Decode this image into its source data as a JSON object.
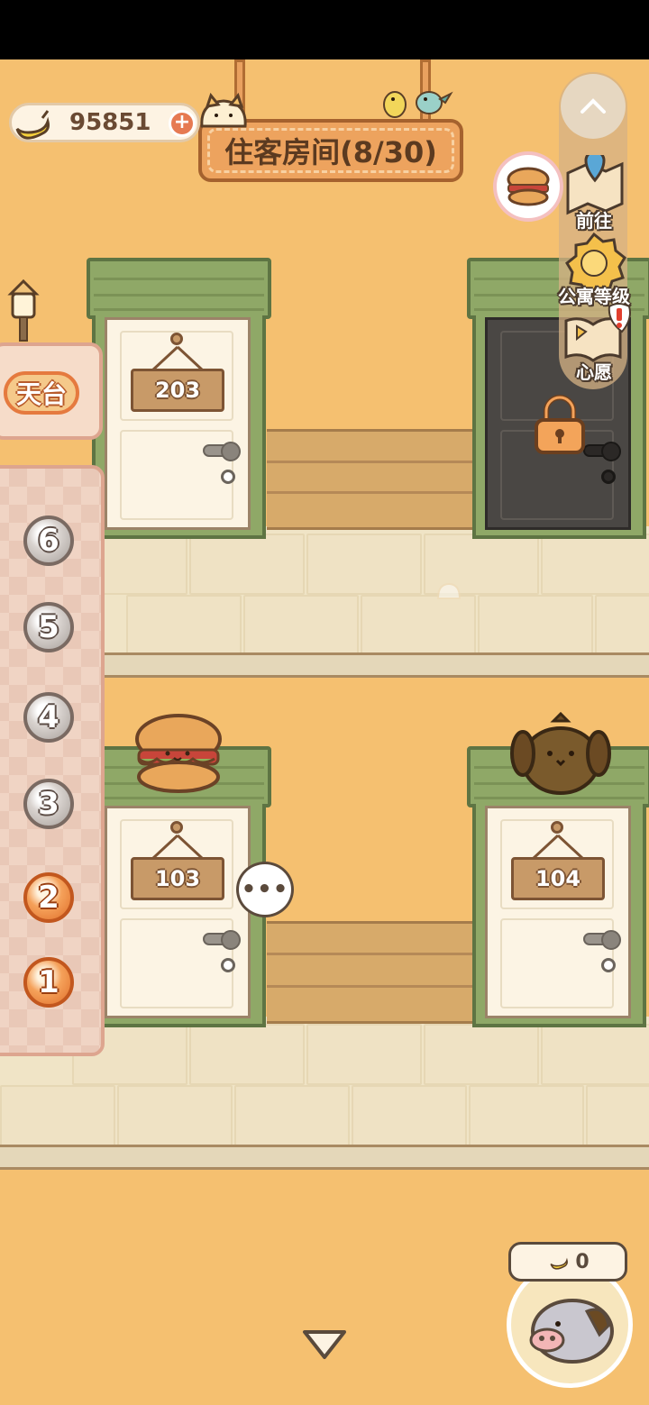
{
  "hud": {
    "currency_amount": "95851",
    "title": "住客房间(8/30)"
  },
  "left_panel": {
    "rooftop_label": "天台",
    "floors": [
      "6",
      "5",
      "4",
      "3",
      "2",
      "1"
    ],
    "active_floors": [
      "2",
      "1"
    ]
  },
  "rooms": {
    "room_203": "203",
    "room_103": "103",
    "room_104": "104"
  },
  "right_toolbar": {
    "goto_label": "前往",
    "apartment_level_label": "公寓等级",
    "wish_label": "心愿"
  },
  "chat": {
    "text": "•••"
  },
  "piggy_bank": {
    "count": "0"
  },
  "icons": {
    "currency": "banana-icon",
    "add": "plus-icon",
    "up": "chevron-up-icon",
    "down": "triangle-down-icon",
    "lock": "padlock-icon",
    "alert": "exclamation-icon"
  },
  "colors": {
    "background": "#f5c070",
    "accent": "#e57a3f",
    "awning": "#8fa867"
  }
}
